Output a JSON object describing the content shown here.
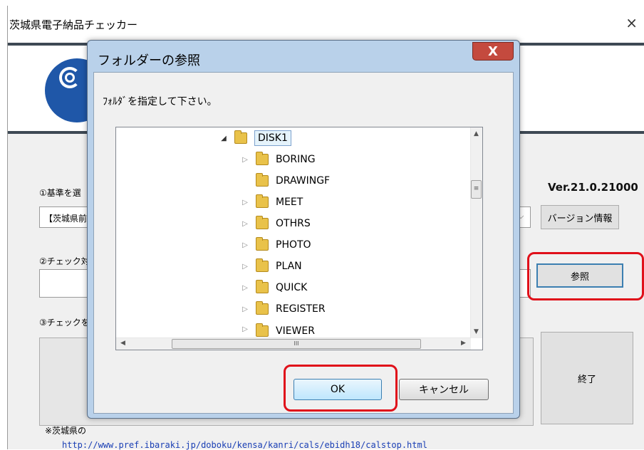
{
  "main": {
    "title": "茨城県電子納品チェッカー",
    "close_glyph": "×",
    "header_tail": ".",
    "label_step1": "①基準を選",
    "select_value": "【茨城県前",
    "caret_glyph": "⌵",
    "version": "Ver.21.0.21000",
    "version_info_button": "バージョン情報",
    "label_step2": "②チェック対",
    "browse_button": "参照",
    "label_step3": "③チェックを",
    "exit_button": "終了",
    "note": "※茨城県の",
    "url": "http://www.pref.ibaraki.jp/doboku/kensa/kanri/cals/ebidh18/calstop.html"
  },
  "dialog": {
    "title": "フォルダーの参照",
    "close_glyph": "X",
    "prompt": "ﾌｫﾙﾀﾞを指定して下さい。",
    "tree": {
      "root": {
        "label": "DISK1",
        "expander": "◢"
      },
      "items": [
        {
          "label": "BORING",
          "expander": "▷"
        },
        {
          "label": "DRAWINGF",
          "expander": ""
        },
        {
          "label": "MEET",
          "expander": "▷"
        },
        {
          "label": "OTHRS",
          "expander": "▷"
        },
        {
          "label": "PHOTO",
          "expander": "▷"
        },
        {
          "label": "PLAN",
          "expander": "▷"
        },
        {
          "label": "QUICK",
          "expander": "▷"
        },
        {
          "label": "REGISTER",
          "expander": "▷"
        },
        {
          "label": "VIEWER",
          "expander": "▷"
        }
      ]
    },
    "scroll_up": "▲",
    "scroll_down": "▼",
    "scroll_left": "◀",
    "scroll_right": "▶",
    "vthumb_grip": "≡",
    "hthumb_grip": "III",
    "ok_button": "OK",
    "cancel_button": "キャンセル"
  },
  "colors": {
    "highlight": "#e0101a",
    "link": "#1a3fb5",
    "logo": "#1f57a8"
  }
}
